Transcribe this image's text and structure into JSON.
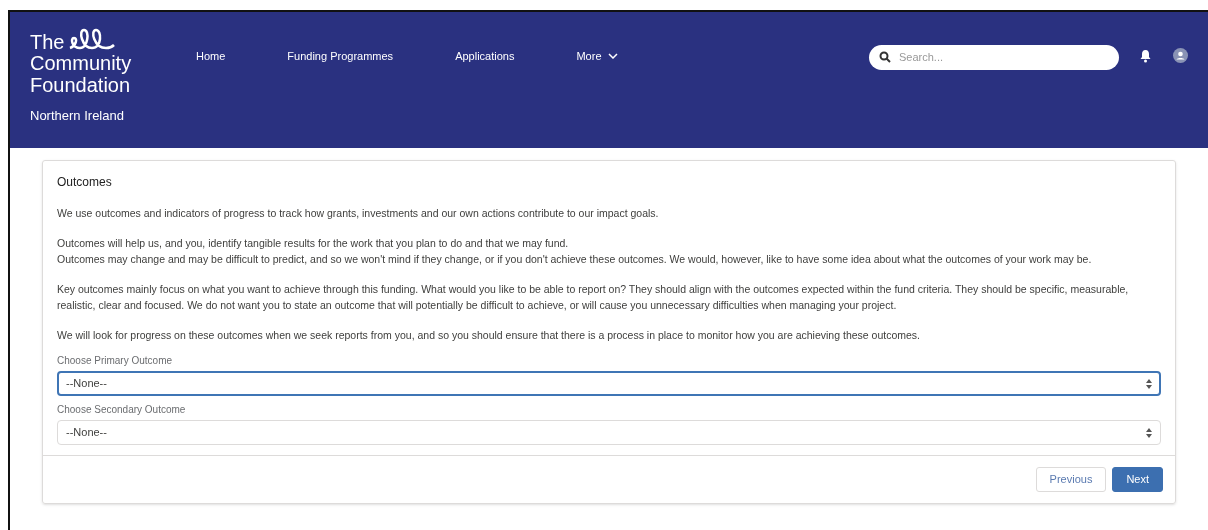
{
  "header": {
    "logo": {
      "lines": [
        "The",
        "Community",
        "Foundation",
        "Northern Ireland"
      ]
    },
    "nav": [
      {
        "label": "Home",
        "dropdown": false
      },
      {
        "label": "Funding Programmes",
        "dropdown": false
      },
      {
        "label": "Applications",
        "dropdown": false
      },
      {
        "label": "More",
        "dropdown": true
      }
    ],
    "search": {
      "placeholder": "Search..."
    }
  },
  "card": {
    "title": "Outcomes",
    "paragraphs": [
      {
        "lines": [
          "We use outcomes and indicators of progress to track how grants, investments and our own actions contribute to our impact goals."
        ]
      },
      {
        "lines": [
          "Outcomes will help us, and you, identify tangible results for the work that you plan to do and that we may fund.",
          "Outcomes may change and may be difficult to predict, and so we won't mind if they change, or if you don't achieve these outcomes. We would, however, like to have some idea about what the outcomes of your work may be."
        ]
      },
      {
        "lines": [
          "Key outcomes mainly focus on what you want to achieve through this funding. What would you like to be able to report on? They should align with the outcomes expected within the fund criteria. They should be specific, measurable, realistic, clear and focused. We do not want you to state an outcome that will potentially be difficult to achieve, or will cause you unnecessary difficulties when managing your project."
        ]
      },
      {
        "lines": [
          "We will look for progress on these outcomes when we seek reports from you, and so you should ensure that there is a process in place to monitor how you are achieving these outcomes."
        ]
      }
    ],
    "fields": [
      {
        "label": "Choose Primary Outcome",
        "value": "--None--",
        "focused": true
      },
      {
        "label": "Choose Secondary Outcome",
        "value": "--None--",
        "focused": false
      }
    ],
    "buttons": [
      {
        "label": "Previous",
        "kind": "secondary"
      },
      {
        "label": "Next",
        "kind": "primary"
      }
    ]
  }
}
